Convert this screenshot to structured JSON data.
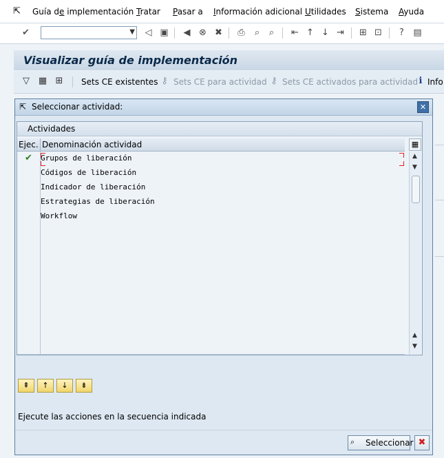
{
  "menubar": {
    "items": [
      {
        "pre": "Guía d",
        "u": "e",
        "post": " implementación"
      },
      {
        "pre": "",
        "u": "T",
        "post": "ratar"
      },
      {
        "pre": "",
        "u": "P",
        "post": "asar a"
      },
      {
        "pre": "",
        "u": "I",
        "post": "nformación adicional"
      },
      {
        "pre": "",
        "u": "U",
        "post": "tilidades"
      },
      {
        "pre": "",
        "u": "S",
        "post": "istema"
      },
      {
        "pre": "",
        "u": "A",
        "post": "yuda"
      }
    ]
  },
  "toolbar": {
    "command_value": ""
  },
  "page": {
    "title": "Visualizar guía de implementación"
  },
  "app_toolbar": {
    "sets_existing": "Sets CE existentes",
    "sets_for_activity": "Sets CE para actividad",
    "sets_activated": "Sets CE activados para actividad",
    "info": "Info"
  },
  "dialog": {
    "title": "Seleccionar actividad:",
    "table_title": "Actividades",
    "col_ejec": "Ejec.",
    "col_name": "Denominación actividad",
    "rows": [
      {
        "done": true,
        "name": "Grupos de liberación"
      },
      {
        "done": false,
        "name": "Códigos de liberación"
      },
      {
        "done": false,
        "name": "Indicador de liberación"
      },
      {
        "done": false,
        "name": "Estrategias de liberación"
      },
      {
        "done": false,
        "name": "Workflow"
      },
      {
        "done": false,
        "name": ""
      },
      {
        "done": false,
        "name": ""
      },
      {
        "done": false,
        "name": ""
      },
      {
        "done": false,
        "name": ""
      },
      {
        "done": false,
        "name": ""
      },
      {
        "done": false,
        "name": ""
      },
      {
        "done": false,
        "name": ""
      },
      {
        "done": false,
        "name": ""
      },
      {
        "done": false,
        "name": ""
      }
    ],
    "check_glyph": "✔",
    "hint": "Ejecute las acciones en la secuencia indicada",
    "select_label": "Seleccionar",
    "cancel_glyph": "✖"
  }
}
